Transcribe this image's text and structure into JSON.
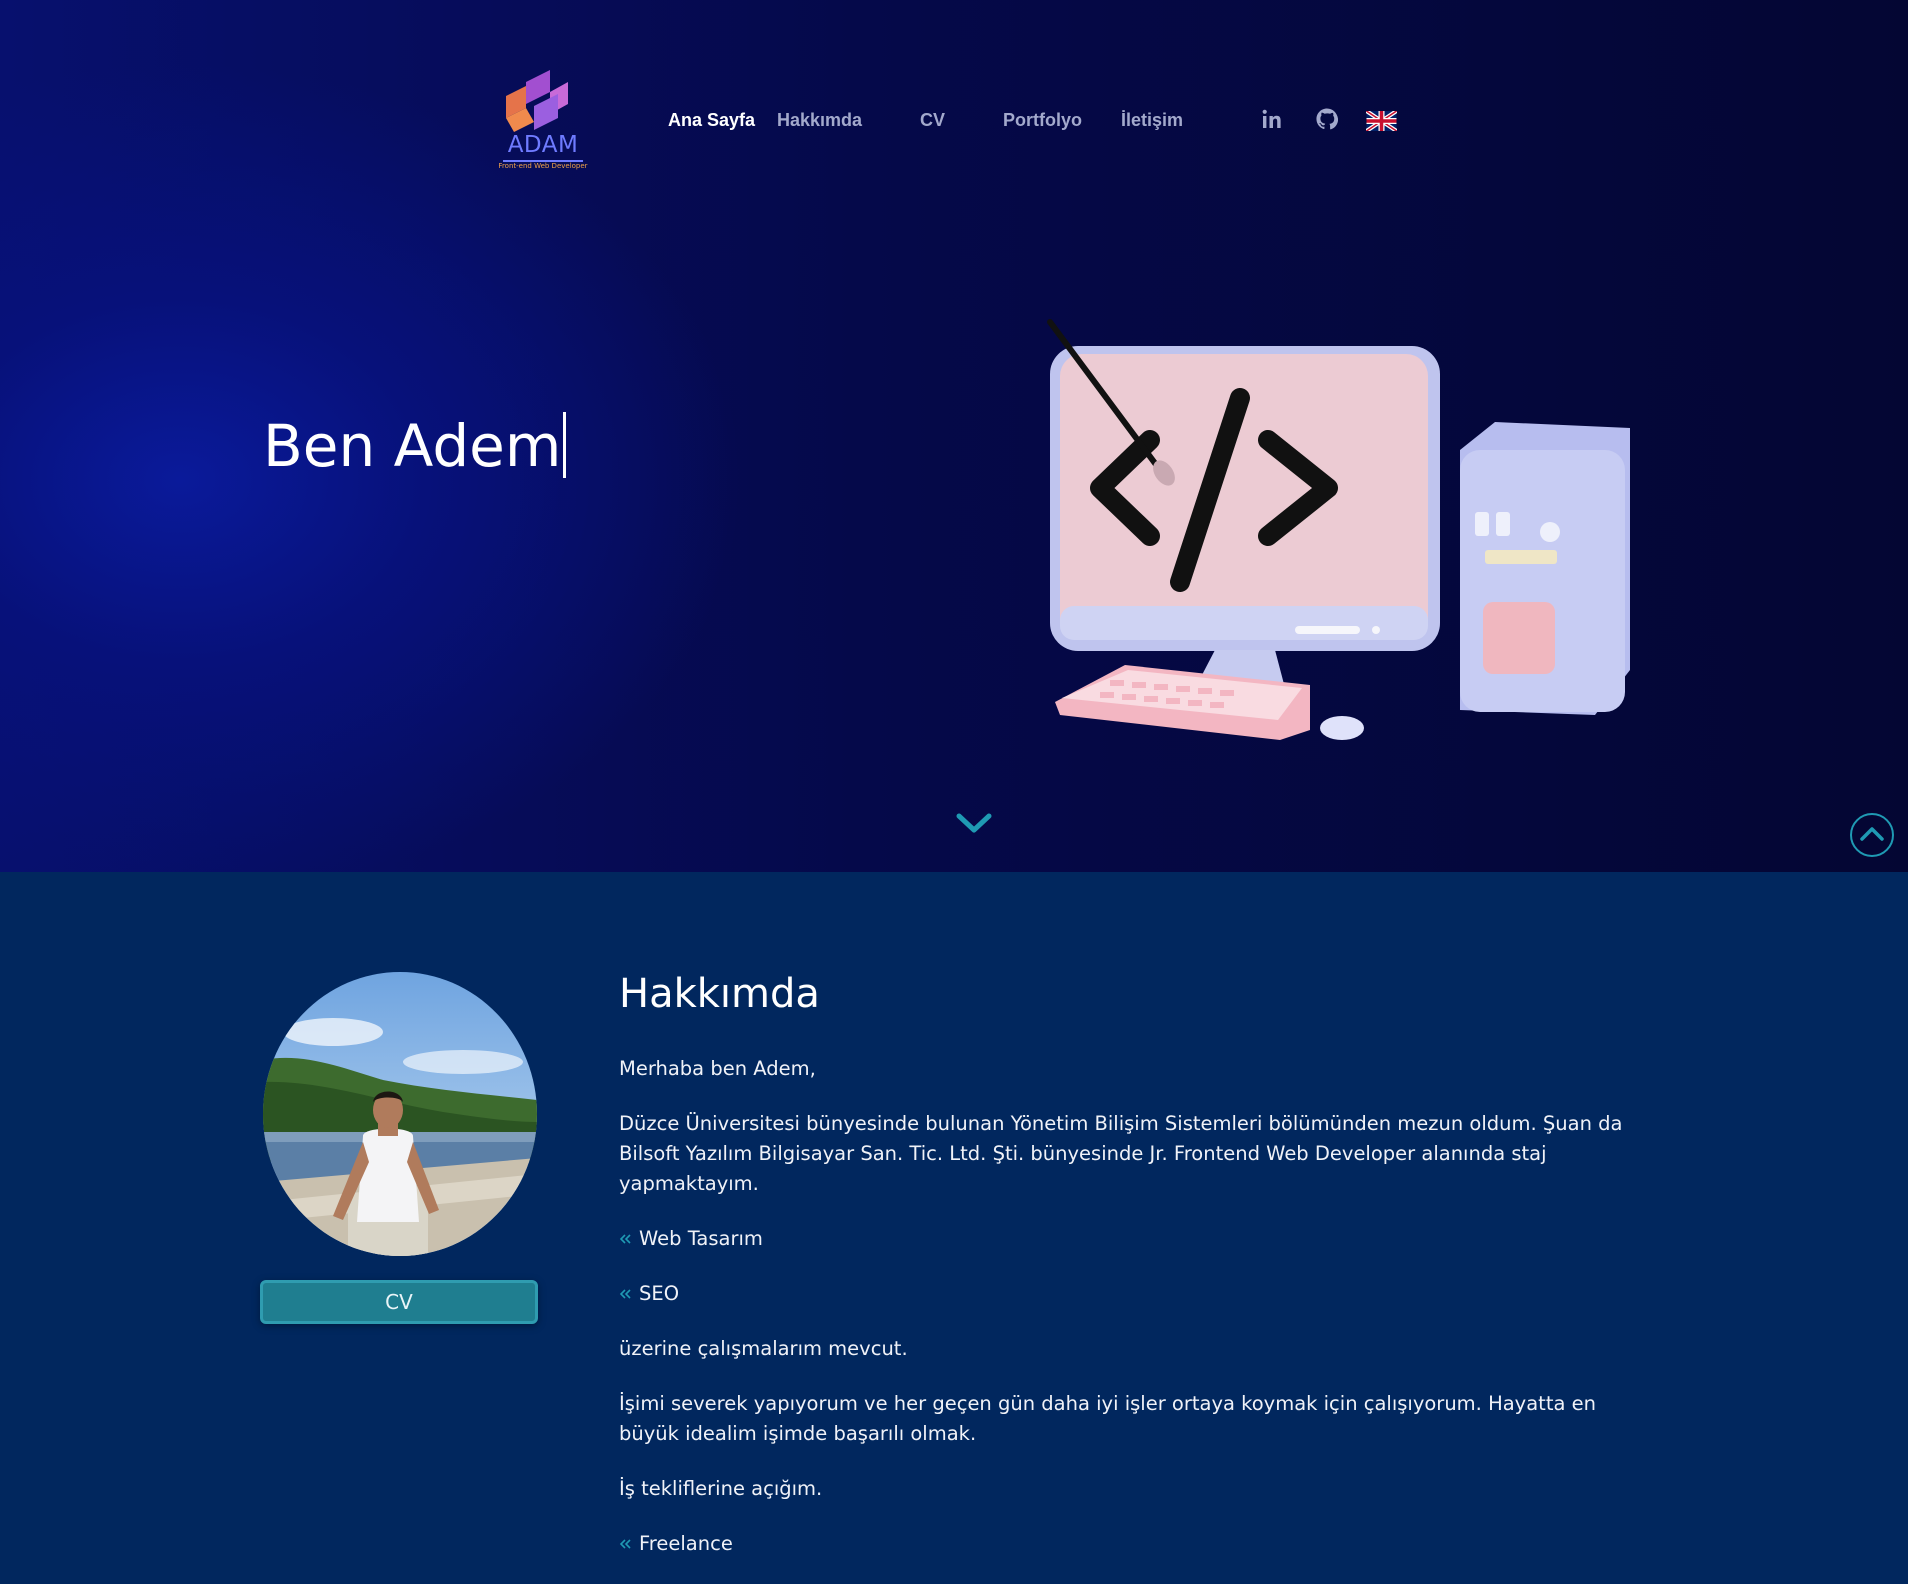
{
  "logo": {
    "word": "ADAM",
    "tagline": "Front-end Web Developer"
  },
  "nav": {
    "items": [
      {
        "label": "Ana Sayfa",
        "active": true
      },
      {
        "label": "Hakkımda",
        "active": false
      },
      {
        "label": "CV",
        "active": false
      },
      {
        "label": "Portfolyo",
        "active": false
      },
      {
        "label": "İletişim",
        "active": false
      }
    ],
    "icons": [
      "linkedin-icon",
      "github-icon",
      "uk-flag-icon"
    ]
  },
  "hero": {
    "title": "Ben Adem"
  },
  "about": {
    "title": "Hakkımda",
    "cv_button": "CV",
    "paragraphs": {
      "p1": "Merhaba ben Adem,",
      "p2": "Düzce Üniversitesi bünyesinde bulunan Yönetim Bilişim Sistemleri bölümünden mezun oldum. Şuan da Bilsoft Yazılım Bilgisayar San. Tic. Ltd. Şti. bünyesinde Jr. Frontend Web Developer alanında staj yapmaktayım.",
      "b1": "Web Tasarım",
      "b2": "SEO",
      "p3": "üzerine çalışmalarım mevcut.",
      "p4": "İşimi severek yapıyorum ve her geçen gün daha iyi işler ortaya koymak için çalışıyorum. Hayatta en büyük idealim işimde başarılı olmak.",
      "p5": "İş tekliflerine açığım.",
      "b3": "Freelance"
    }
  },
  "colors": {
    "hero_bg": "#05094a",
    "about_bg": "#01275e",
    "accent": "#1f7e90",
    "nav_inactive": "#a3a9cc"
  }
}
